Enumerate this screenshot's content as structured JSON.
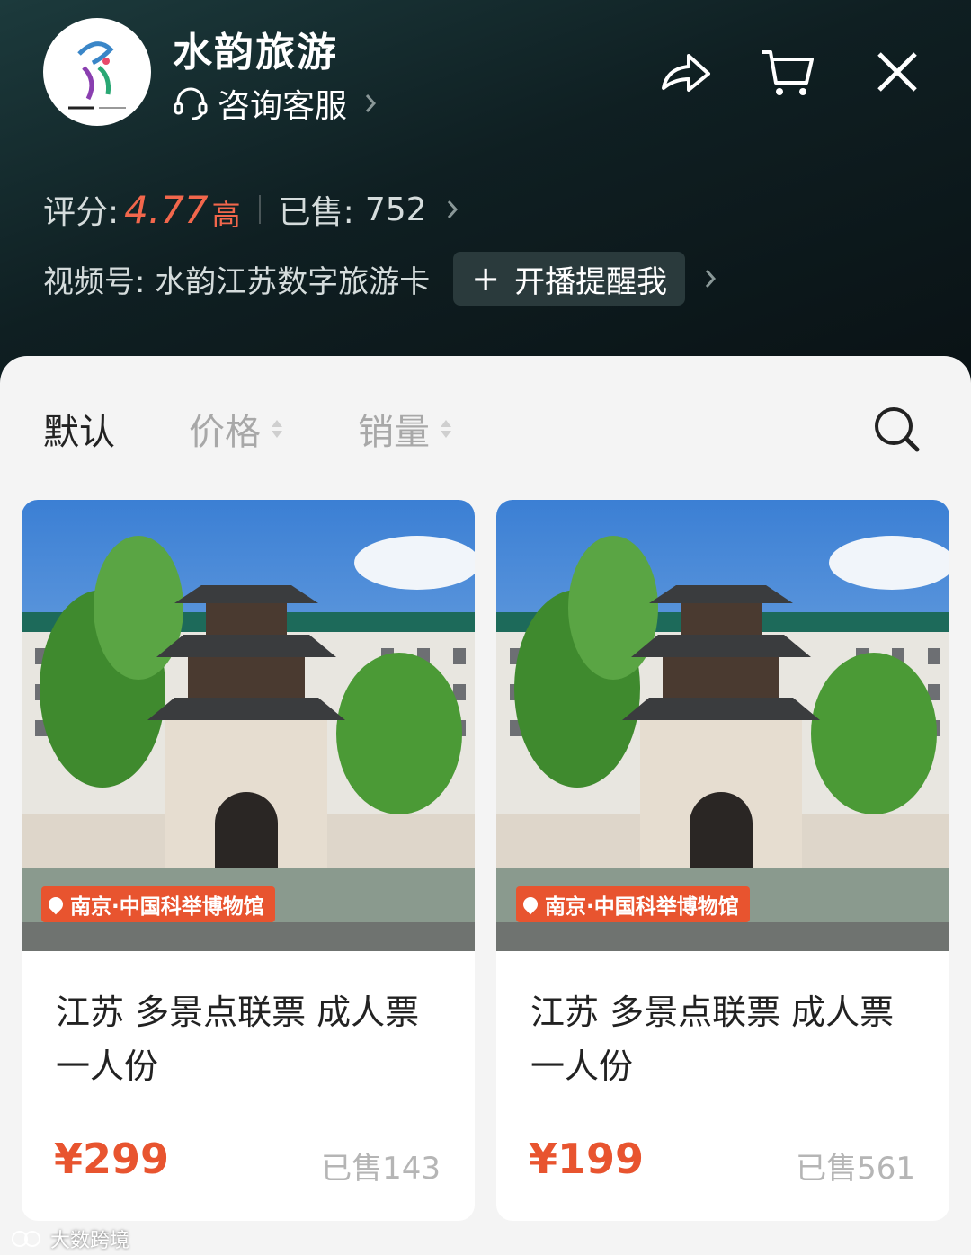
{
  "header": {
    "shop_name": "水韵旅游",
    "consult_label": "咨询客服",
    "rating_label": "评分:",
    "rating_value": "4.77",
    "rating_tag": "高",
    "sold_label": "已售:",
    "sold_value": "752",
    "video_label": "视频号: 水韵江苏数字旅游卡",
    "remind_label": "开播提醒我",
    "icons": [
      "headset-icon",
      "share-icon",
      "cart-icon",
      "close-icon"
    ]
  },
  "sort_bar": {
    "default_label": "默认",
    "price_label": "价格",
    "sales_label": "销量"
  },
  "products": [
    {
      "location": "南京·中国科举博物馆",
      "title": "江苏 多景点联票 成人票 一人份",
      "price": "¥299",
      "sold": "已售143"
    },
    {
      "location": "南京·中国科举博物馆",
      "title": "江苏 多景点联票 成人票 一人份",
      "price": "¥199",
      "sold": "已售561"
    }
  ],
  "watermark": "大数跨境",
  "colors": {
    "accent": "#e8542f",
    "rating": "#f2674c"
  }
}
